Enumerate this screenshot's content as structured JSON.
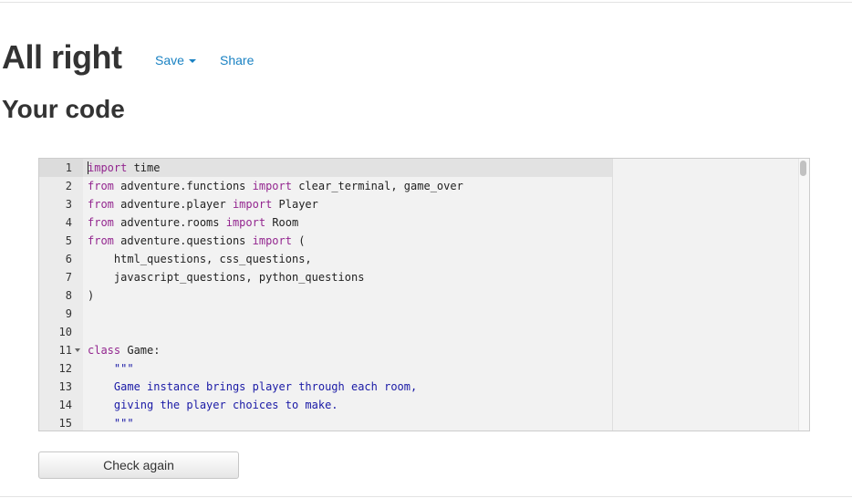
{
  "header": {
    "title": "All right",
    "save_label": "Save",
    "share_label": "Share"
  },
  "section_title": "Your code",
  "editor": {
    "lines": [
      {
        "n": "1",
        "tokens": [
          {
            "t": "import",
            "c": "kw"
          },
          {
            "t": " time",
            "c": ""
          }
        ]
      },
      {
        "n": "2",
        "tokens": [
          {
            "t": "from",
            "c": "kw"
          },
          {
            "t": " adventure.functions ",
            "c": ""
          },
          {
            "t": "import",
            "c": "kw"
          },
          {
            "t": " clear_terminal, game_over",
            "c": ""
          }
        ]
      },
      {
        "n": "3",
        "tokens": [
          {
            "t": "from",
            "c": "kw"
          },
          {
            "t": " adventure.player ",
            "c": ""
          },
          {
            "t": "import",
            "c": "kw"
          },
          {
            "t": " Player",
            "c": ""
          }
        ]
      },
      {
        "n": "4",
        "tokens": [
          {
            "t": "from",
            "c": "kw"
          },
          {
            "t": " adventure.rooms ",
            "c": ""
          },
          {
            "t": "import",
            "c": "kw"
          },
          {
            "t": " Room",
            "c": ""
          }
        ]
      },
      {
        "n": "5",
        "tokens": [
          {
            "t": "from",
            "c": "kw"
          },
          {
            "t": " adventure.questions ",
            "c": ""
          },
          {
            "t": "import",
            "c": "kw"
          },
          {
            "t": " (",
            "c": ""
          }
        ]
      },
      {
        "n": "6",
        "tokens": [
          {
            "t": "    html_questions, css_questions,",
            "c": ""
          }
        ]
      },
      {
        "n": "7",
        "tokens": [
          {
            "t": "    javascript_questions, python_questions",
            "c": ""
          }
        ]
      },
      {
        "n": "8",
        "tokens": [
          {
            "t": ")",
            "c": ""
          }
        ]
      },
      {
        "n": "9",
        "tokens": []
      },
      {
        "n": "10",
        "tokens": []
      },
      {
        "n": "11",
        "fold": true,
        "tokens": [
          {
            "t": "class",
            "c": "kw"
          },
          {
            "t": " Game:",
            "c": ""
          }
        ]
      },
      {
        "n": "12",
        "tokens": [
          {
            "t": "    \"\"\"",
            "c": "str"
          }
        ]
      },
      {
        "n": "13",
        "tokens": [
          {
            "t": "    Game instance brings player through each room,",
            "c": "str"
          }
        ]
      },
      {
        "n": "14",
        "tokens": [
          {
            "t": "    giving the player choices to make.",
            "c": "str"
          }
        ]
      },
      {
        "n": "15",
        "tokens": [
          {
            "t": "    \"\"\"",
            "c": "str"
          }
        ]
      }
    ]
  },
  "check_button_label": "Check again",
  "colors": {
    "link": "#1a82c3",
    "keyword": "#93268f",
    "string": "#1a1aa6"
  }
}
